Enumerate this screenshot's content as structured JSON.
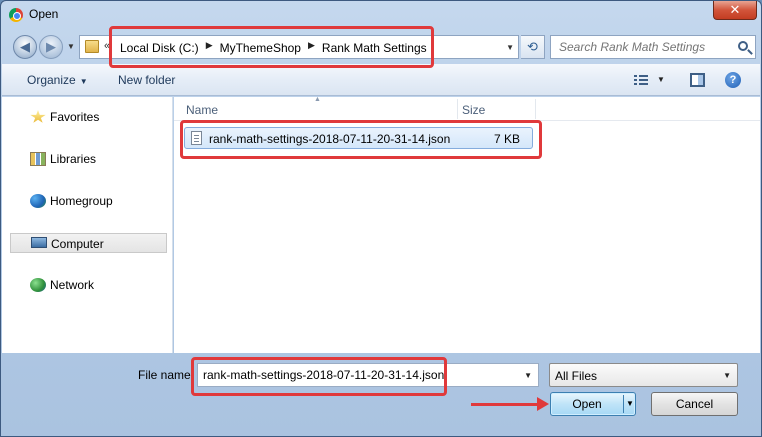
{
  "window": {
    "title": "Open",
    "close_glyph": "✕",
    "accent": "#e0393b"
  },
  "navigation": {
    "back_glyph": "◀",
    "forward_glyph": "▶",
    "breadcrumb_prefix": "«",
    "breadcrumbs": [
      "Local Disk (C:)",
      "MyThemeShop",
      "Rank Math Settings"
    ],
    "refresh_glyph": "⟲",
    "search_placeholder": "Search Rank Math Settings"
  },
  "toolbar": {
    "organize_label": "Organize",
    "new_folder_label": "New folder",
    "help_glyph": "?"
  },
  "sidebar": {
    "items": [
      {
        "label": "Favorites",
        "icon": "star-icon"
      },
      {
        "label": "Libraries",
        "icon": "libraries-icon"
      },
      {
        "label": "Homegroup",
        "icon": "homegroup-icon"
      },
      {
        "label": "Computer",
        "icon": "computer-icon",
        "selected": true
      },
      {
        "label": "Network",
        "icon": "network-icon"
      }
    ]
  },
  "file_list": {
    "columns": {
      "name": "Name",
      "size": "Size"
    },
    "files": [
      {
        "name": "rank-math-settings-2018-07-11-20-31-14.json",
        "size": "7 KB"
      }
    ]
  },
  "bottom": {
    "file_name_label": "File name:",
    "file_name_value": "rank-math-settings-2018-07-11-20-31-14.json",
    "filter_value": "All Files",
    "open_label": "Open",
    "cancel_label": "Cancel"
  }
}
